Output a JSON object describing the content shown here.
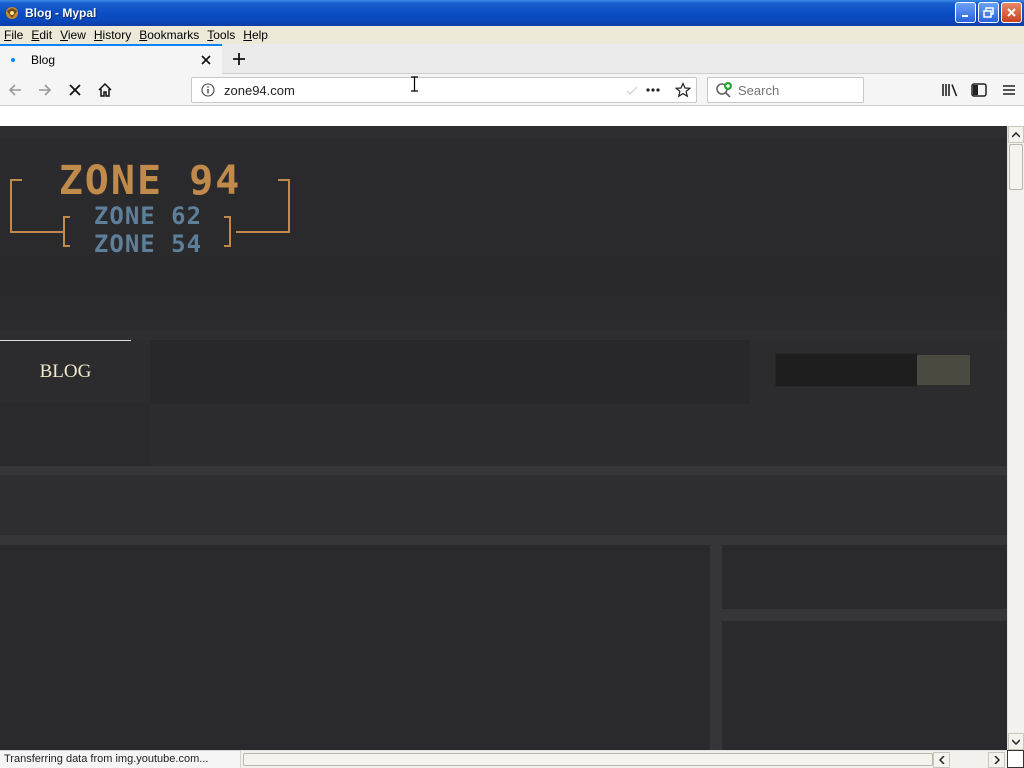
{
  "window": {
    "title": "Blog - Mypal",
    "controls": [
      "minimize",
      "restore",
      "close"
    ]
  },
  "menubar": {
    "items": [
      {
        "label": "File",
        "accel": "F",
        "rest": "ile"
      },
      {
        "label": "Edit",
        "accel": "E",
        "rest": "dit"
      },
      {
        "label": "View",
        "accel": "V",
        "rest": "iew"
      },
      {
        "label": "History",
        "accel": "H",
        "rest": "istory"
      },
      {
        "label": "Bookmarks",
        "accel": "B",
        "rest": "ookmarks"
      },
      {
        "label": "Tools",
        "accel": "T",
        "rest": "ools"
      },
      {
        "label": "Help",
        "accel": "H",
        "rest": "elp"
      }
    ]
  },
  "tabs": [
    {
      "title": "Blog",
      "active": true
    }
  ],
  "navbar": {
    "url": "zone94.com",
    "search_placeholder": "Search",
    "loading": true
  },
  "page": {
    "logo": {
      "line1": "ZONE 94",
      "line2": "ZONE 62",
      "line3": "ZONE 54",
      "colors": {
        "main": "#c08a4a",
        "sub": "#5d7f99"
      }
    },
    "nav": {
      "active_item": "BLOG"
    }
  },
  "statusbar": {
    "text": "Transferring data from img.youtube.com..."
  },
  "colors": {
    "page_bg": "#2e2e30",
    "accent_tab": "#0a84ff",
    "titlebar": "#0c4dc4"
  }
}
